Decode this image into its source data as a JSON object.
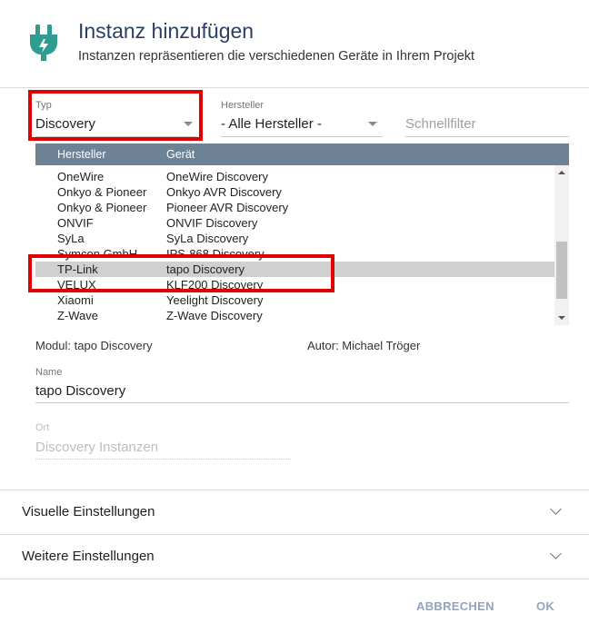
{
  "dialog": {
    "title": "Instanz hinzufügen",
    "subtitle": "Instanzen repräsentieren die verschiedenen Geräte in Ihrem Projekt",
    "icon": "plug-icon",
    "accent_color": "#2e9c8f"
  },
  "filters": {
    "type": {
      "label": "Typ",
      "value": "Discovery"
    },
    "manufacturer": {
      "label": "Hersteller",
      "value": "- Alle Hersteller -"
    },
    "quickfilter": {
      "placeholder": "Schnellfilter"
    }
  },
  "table": {
    "columns": [
      "Hersteller",
      "Gerät"
    ],
    "rows": [
      {
        "manufacturer": "",
        "device": "",
        "partial": true
      },
      {
        "manufacturer": "OneWire",
        "device": "OneWire Discovery"
      },
      {
        "manufacturer": "Onkyo & Pioneer",
        "device": "Onkyo AVR Discovery"
      },
      {
        "manufacturer": "Onkyo & Pioneer",
        "device": "Pioneer AVR Discovery"
      },
      {
        "manufacturer": "ONVIF",
        "device": "ONVIF Discovery"
      },
      {
        "manufacturer": "SyLa",
        "device": "SyLa Discovery"
      },
      {
        "manufacturer": "Symcon GmbH",
        "device": "IPS-868 Discovery"
      },
      {
        "manufacturer": "TP-Link",
        "device": "tapo Discovery",
        "selected": true
      },
      {
        "manufacturer": "VELUX",
        "device": "KLF200 Discovery"
      },
      {
        "manufacturer": "Xiaomi",
        "device": "Yeelight Discovery"
      },
      {
        "manufacturer": "Z-Wave",
        "device": "Z-Wave Discovery"
      }
    ]
  },
  "details": {
    "module": "Modul: tapo Discovery",
    "author": "Autor: Michael Tröger",
    "name_label": "Name",
    "name_value": "tapo Discovery",
    "location_label": "Ort",
    "location_value": "Discovery Instanzen"
  },
  "sections": [
    {
      "label": "Visuelle Einstellungen"
    },
    {
      "label": "Weitere Einstellungen"
    }
  ],
  "buttons": {
    "cancel": "ABBRECHEN",
    "ok": "OK"
  },
  "highlight_color": "#e00000"
}
